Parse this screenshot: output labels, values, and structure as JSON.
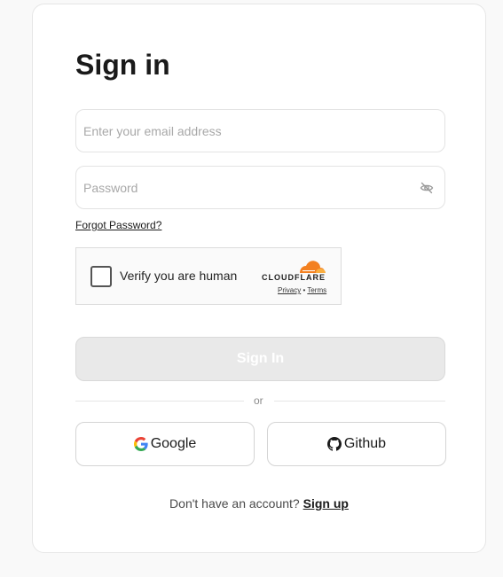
{
  "form": {
    "title": "Sign in",
    "email": {
      "placeholder": "Enter your email address",
      "value": ""
    },
    "password": {
      "placeholder": "Password",
      "value": "",
      "toggle_icon": "eye-off-icon"
    },
    "forgot_password": "Forgot Password?",
    "submit_label": "Sign In"
  },
  "captcha": {
    "label": "Verify you are human",
    "provider": "CLOUDFLARE",
    "privacy": "Privacy",
    "separator": "•",
    "terms": "Terms",
    "logo_color": "#f38020"
  },
  "divider": {
    "text": "or"
  },
  "oauth": {
    "google_label": "Google",
    "github_label": "Github"
  },
  "footer": {
    "prompt": "Don't have an account?",
    "signup_label": "Sign up"
  },
  "colors": {
    "accent_orange": "#f38020",
    "disabled_button_bg": "#e9e9e9"
  }
}
